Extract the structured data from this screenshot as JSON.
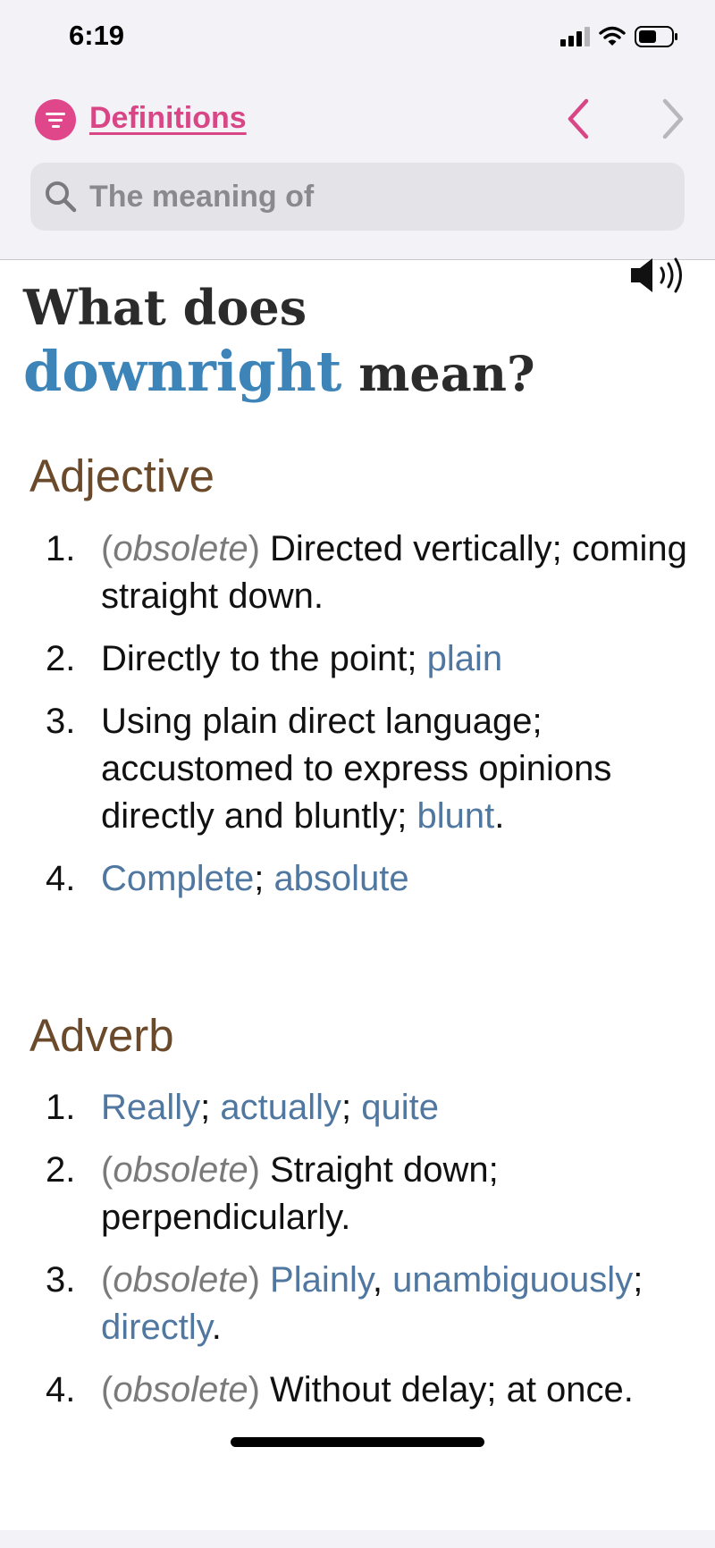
{
  "status_bar": {
    "time": "6:19"
  },
  "nav": {
    "title": "Definitions"
  },
  "search": {
    "placeholder": "The meaning of"
  },
  "heading": {
    "line1": "What does",
    "word": "downright",
    "suffix": "mean?"
  },
  "sections": [
    {
      "pos": "Adjective",
      "items": [
        {
          "num": "1.",
          "parts": [
            {
              "t": "(",
              "k": "label"
            },
            {
              "t": "obsolete",
              "k": "label-em"
            },
            {
              "t": ")",
              "k": "label"
            },
            {
              "t": " Directed vertically; coming straight down.",
              "k": "text"
            }
          ]
        },
        {
          "num": "2.",
          "parts": [
            {
              "t": "Directly to the point; ",
              "k": "text"
            },
            {
              "t": "plain",
              "k": "link"
            }
          ]
        },
        {
          "num": "3.",
          "parts": [
            {
              "t": "Using plain direct language; accustomed to express opinions directly and bluntly; ",
              "k": "text"
            },
            {
              "t": "blunt",
              "k": "link"
            },
            {
              "t": ".",
              "k": "text"
            }
          ]
        },
        {
          "num": "4.",
          "parts": [
            {
              "t": "Complete",
              "k": "link"
            },
            {
              "t": "; ",
              "k": "text"
            },
            {
              "t": "absolute",
              "k": "link"
            }
          ]
        }
      ]
    },
    {
      "pos": "Adverb",
      "items": [
        {
          "num": "1.",
          "parts": [
            {
              "t": "Really",
              "k": "link"
            },
            {
              "t": "; ",
              "k": "text"
            },
            {
              "t": "actually",
              "k": "link"
            },
            {
              "t": "; ",
              "k": "text"
            },
            {
              "t": "quite",
              "k": "link"
            }
          ]
        },
        {
          "num": "2.",
          "parts": [
            {
              "t": "(",
              "k": "label"
            },
            {
              "t": "obsolete",
              "k": "label-em"
            },
            {
              "t": ")",
              "k": "label"
            },
            {
              "t": " Straight down; perpendicularly.",
              "k": "text"
            }
          ]
        },
        {
          "num": "3.",
          "parts": [
            {
              "t": "(",
              "k": "label"
            },
            {
              "t": "obsolete",
              "k": "label-em"
            },
            {
              "t": ")",
              "k": "label"
            },
            {
              "t": " ",
              "k": "text"
            },
            {
              "t": "Plainly",
              "k": "link"
            },
            {
              "t": ", ",
              "k": "text"
            },
            {
              "t": "unambiguously",
              "k": "link"
            },
            {
              "t": "; ",
              "k": "text"
            },
            {
              "t": "directly",
              "k": "link"
            },
            {
              "t": ".",
              "k": "text"
            }
          ]
        },
        {
          "num": "4.",
          "parts": [
            {
              "t": "(",
              "k": "label"
            },
            {
              "t": "obsolete",
              "k": "label-em"
            },
            {
              "t": ")",
              "k": "label"
            },
            {
              "t": " Without delay; at once.",
              "k": "text"
            }
          ]
        }
      ]
    }
  ],
  "colors": {
    "accent": "#d94686",
    "headword": "#3d84b8",
    "part_of_speech": "#6b4a2b",
    "link": "#4f77a0",
    "label": "#7a7a7a"
  },
  "icons": [
    "filter-icon",
    "chevron-left-icon",
    "chevron-right-icon",
    "search-icon",
    "speaker-icon",
    "wifi-icon",
    "battery-icon",
    "signal-icon"
  ]
}
